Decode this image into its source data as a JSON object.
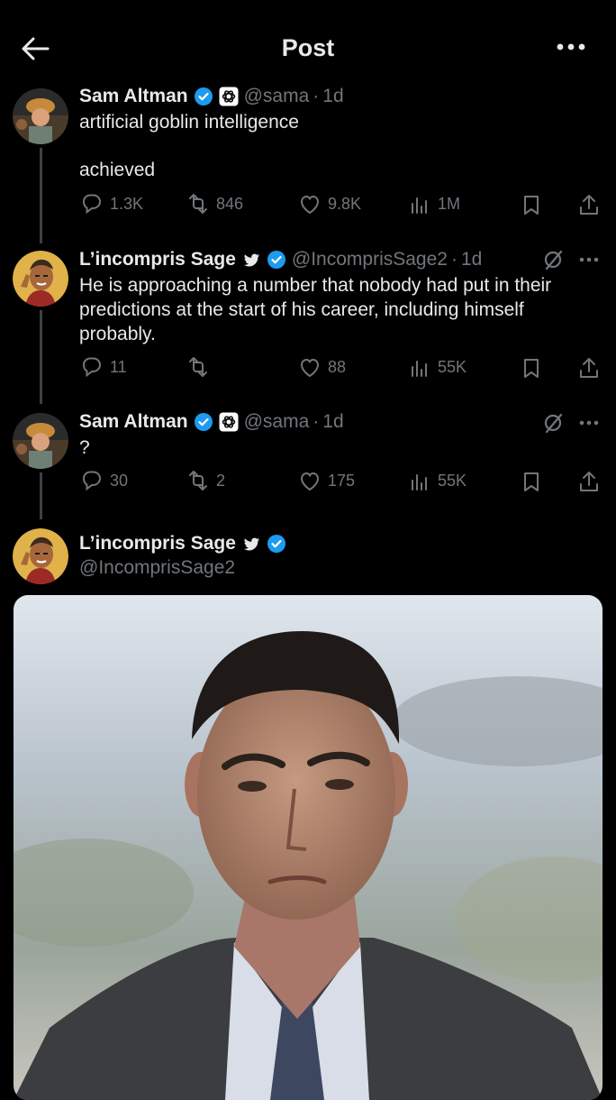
{
  "header": {
    "title": "Post"
  },
  "tweets": [
    {
      "name": "Sam Altman",
      "handle": "@sama",
      "time": "1d",
      "text_line1": "artificial goblin intelligence",
      "text_line2": "achieved",
      "replies": "1.3K",
      "retweets": "846",
      "likes": "9.8K",
      "views": "1M"
    },
    {
      "name": "L’incompris Sage",
      "handle": "@IncomprisSage2",
      "time": "1d",
      "text_line1": "He is approaching a number that nobody had put in their",
      "text_line2": "predictions at the start of his career, including himself",
      "text_line3": "probably.",
      "replies": "11",
      "retweets": "",
      "likes": "88",
      "views": "55K"
    },
    {
      "name": "Sam Altman",
      "handle": "@sama",
      "time": "1d",
      "text_line1": "?",
      "replies": "30",
      "retweets": "2",
      "likes": "175",
      "views": "55K"
    },
    {
      "name": "L’incompris Sage",
      "handle": "@IncomprisSage2"
    }
  ],
  "colors": {
    "background": "#000000",
    "text": "#e7e9ea",
    "muted": "#71767b",
    "verified": "#1d9bf0",
    "thread_line": "#3e4144"
  },
  "icons": [
    "back-arrow-icon",
    "more-icon",
    "verified-icon",
    "openai-icon",
    "bird-icon",
    "grok-icon",
    "reply-icon",
    "retweet-icon",
    "like-icon",
    "views-icon",
    "bookmark-icon",
    "share-icon"
  ]
}
